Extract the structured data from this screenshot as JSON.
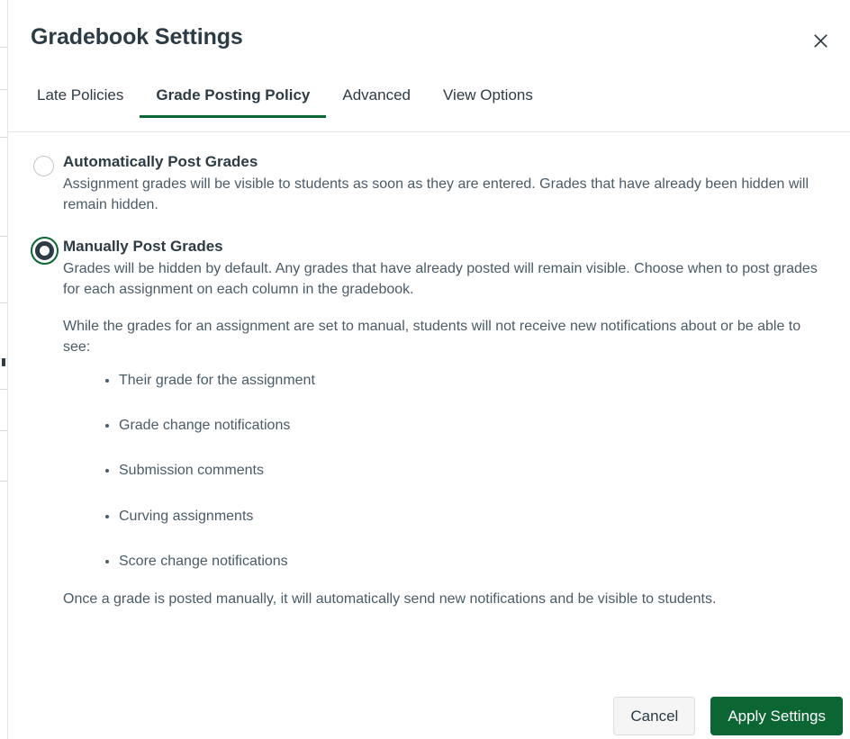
{
  "modal": {
    "title": "Gradebook Settings",
    "close_icon": "close-icon",
    "close_label": "Close"
  },
  "tabs": [
    {
      "label": "Late Policies",
      "active": false
    },
    {
      "label": "Grade Posting Policy",
      "active": true
    },
    {
      "label": "Advanced",
      "active": false
    },
    {
      "label": "View Options",
      "active": false
    }
  ],
  "grade_posting_policy": {
    "options": [
      {
        "label": "Automatically Post Grades",
        "selected": false,
        "description": "Assignment grades will be visible to students as soon as they are entered. Grades that have already been hidden will remain hidden."
      },
      {
        "label": "Manually Post Grades",
        "selected": true,
        "description": "Grades will be hidden by default. Any grades that have already posted will remain visible. Choose when to post grades for each assignment on each column in the gradebook.",
        "description2": "While the grades for an assignment are set to manual, students will not receive new notifications about or be able to see:",
        "bullets": [
          "Their grade for the assignment",
          "Grade change notifications",
          "Submission comments",
          "Curving assignments",
          "Score change notifications"
        ],
        "footnote": "Once a grade is posted manually, it will automatically send new notifications and be visible to students."
      }
    ]
  },
  "footer": {
    "cancel_label": "Cancel",
    "apply_label": "Apply Settings"
  },
  "colors": {
    "brand_green": "#0B6634",
    "text_dark": "#2D3B45",
    "text_body": "#4A5B68",
    "border": "#E3E5E7"
  }
}
